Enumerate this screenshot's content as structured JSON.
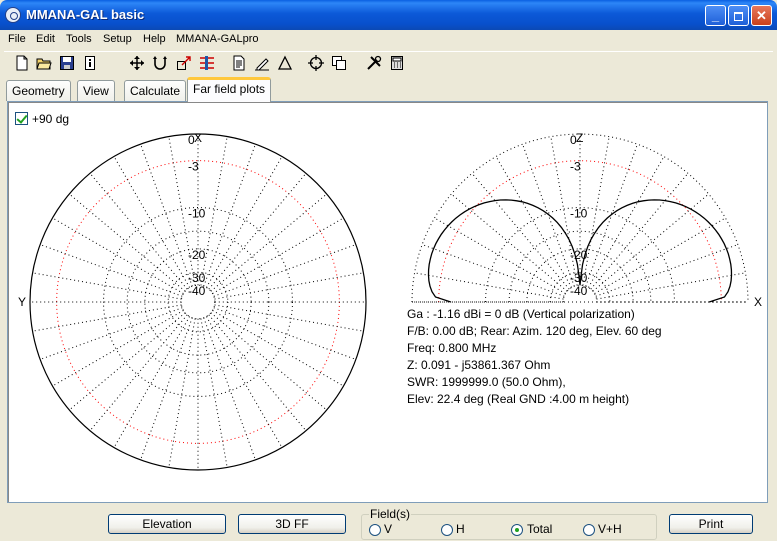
{
  "window": {
    "title": "MMANA-GAL basic"
  },
  "menu": [
    "File",
    "Edit",
    "Tools",
    "Setup",
    "Help",
    "MMANA-GALpro"
  ],
  "toolbar_icons": [
    "new-file-icon",
    "open-folder-icon",
    "save-icon",
    "info-icon",
    "move-icon",
    "rotate-icon",
    "stretch-icon",
    "wire-edit-icon",
    "document-icon",
    "pen-icon",
    "triangle-icon",
    "target-icon",
    "copy-icon",
    "tools-icon",
    "calculator-icon"
  ],
  "tabs": [
    {
      "label": "Geometry",
      "active": false
    },
    {
      "label": "View",
      "active": false
    },
    {
      "label": "Calculate",
      "active": false
    },
    {
      "label": "Far field plots",
      "active": true
    }
  ],
  "plot": {
    "checkbox_label": "+90 dg",
    "checkbox_checked": true,
    "azimuth_axes": {
      "top": "X",
      "left": "Y"
    },
    "elevation_axes": {
      "top": "Z",
      "right": "X"
    },
    "ring_labels": [
      "0",
      "-3",
      "-10",
      "-20",
      "-30",
      "-40"
    ],
    "ring_db": [
      0,
      -3,
      -10,
      -20,
      -30,
      -40
    ]
  },
  "info": [
    "Ga : -1.16 dBi = 0 dB  (Vertical polarization)",
    "F/B: 0.00 dB; Rear: Azim. 120 deg,  Elev. 60 deg",
    "Freq: 0.800 MHz",
    "Z: 0.091 - j53861.367 Ohm",
    "SWR: 1999999.0 (50.0 Ohm),",
    "Elev: 22.4 deg (Real GND  :4.00 m height)"
  ],
  "buttons": {
    "elevation": "Elevation",
    "ff3d": "3D FF",
    "print": "Print"
  },
  "fields": {
    "legend": "Field(s)",
    "options": [
      {
        "label": "V",
        "checked": false
      },
      {
        "label": "H",
        "checked": false
      },
      {
        "label": "Total",
        "checked": true
      },
      {
        "label": "V+H",
        "checked": false
      }
    ]
  },
  "colors": {
    "pattern": "#000000",
    "ring_3db": "#ff0000",
    "grid": "#000000"
  }
}
